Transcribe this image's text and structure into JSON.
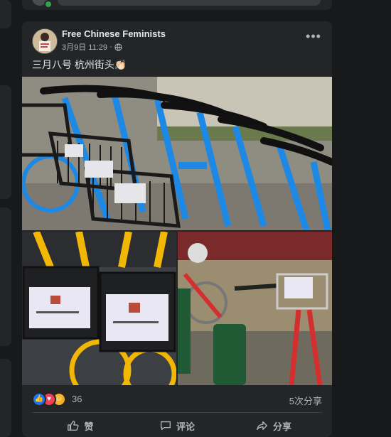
{
  "post": {
    "author": "Free Chinese Feminists",
    "date": "3月9日 11:29",
    "separator": "·",
    "text": "三月八号 杭州街头👏🏻",
    "more_label": "•••"
  },
  "reactions": {
    "count": "36",
    "shares": "5次分享"
  },
  "actions": {
    "like": "赞",
    "comment": "评论",
    "share": "分享"
  },
  "icons": [
    "globe-icon",
    "like-icon",
    "love-icon",
    "care-icon",
    "thumbs-up-icon",
    "comment-icon",
    "share-icon",
    "more-icon"
  ],
  "colors": {
    "background": "#18191a",
    "card": "#242526",
    "text_primary": "#e4e6eb",
    "text_secondary": "#b0b3b8",
    "like_blue": "#1877f2",
    "love_red": "#f33e58",
    "bike_blue": "#1e88e5",
    "bike_yellow": "#f2b705"
  }
}
